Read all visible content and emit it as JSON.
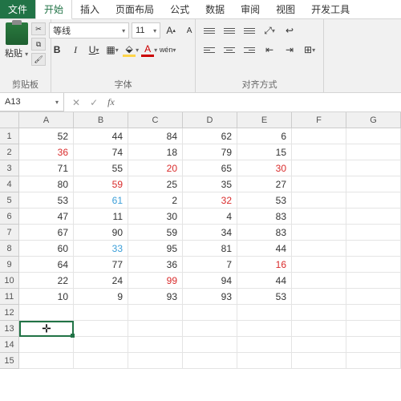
{
  "tabs": {
    "file": "文件",
    "home": "开始",
    "insert": "插入",
    "layout": "页面布局",
    "formula": "公式",
    "data": "数据",
    "review": "审阅",
    "view": "视图",
    "dev": "开发工具"
  },
  "ribbon": {
    "paste": "粘贴",
    "clipboard": "剪贴板",
    "font_name": "等线",
    "font_size": "11",
    "font_group": "字体",
    "align_group": "对齐方式",
    "wen": "wén"
  },
  "namebox": "A13",
  "columns": [
    "A",
    "B",
    "C",
    "D",
    "E",
    "F",
    "G"
  ],
  "rows": [
    "1",
    "2",
    "3",
    "4",
    "5",
    "6",
    "7",
    "8",
    "9",
    "10",
    "11",
    "12",
    "13",
    "14",
    "15"
  ],
  "selected": {
    "row": 12,
    "col": 0
  },
  "cells": [
    [
      {
        "v": "52"
      },
      {
        "v": "44"
      },
      {
        "v": "84"
      },
      {
        "v": "62"
      },
      {
        "v": "6"
      },
      {
        "v": ""
      },
      {
        "v": ""
      }
    ],
    [
      {
        "v": "36",
        "c": "red"
      },
      {
        "v": "74"
      },
      {
        "v": "18"
      },
      {
        "v": "79"
      },
      {
        "v": "15"
      },
      {
        "v": ""
      },
      {
        "v": ""
      }
    ],
    [
      {
        "v": "71"
      },
      {
        "v": "55"
      },
      {
        "v": "20",
        "c": "red"
      },
      {
        "v": "65"
      },
      {
        "v": "30",
        "c": "red"
      },
      {
        "v": ""
      },
      {
        "v": ""
      }
    ],
    [
      {
        "v": "80"
      },
      {
        "v": "59",
        "c": "red"
      },
      {
        "v": "25"
      },
      {
        "v": "35"
      },
      {
        "v": "27"
      },
      {
        "v": ""
      },
      {
        "v": ""
      }
    ],
    [
      {
        "v": "53"
      },
      {
        "v": "61",
        "c": "blue"
      },
      {
        "v": "2"
      },
      {
        "v": "32",
        "c": "red"
      },
      {
        "v": "53"
      },
      {
        "v": ""
      },
      {
        "v": ""
      }
    ],
    [
      {
        "v": "47"
      },
      {
        "v": "11"
      },
      {
        "v": "30"
      },
      {
        "v": "4"
      },
      {
        "v": "83"
      },
      {
        "v": ""
      },
      {
        "v": ""
      }
    ],
    [
      {
        "v": "67"
      },
      {
        "v": "90"
      },
      {
        "v": "59"
      },
      {
        "v": "34"
      },
      {
        "v": "83"
      },
      {
        "v": ""
      },
      {
        "v": ""
      }
    ],
    [
      {
        "v": "60"
      },
      {
        "v": "33",
        "c": "blue"
      },
      {
        "v": "95"
      },
      {
        "v": "81"
      },
      {
        "v": "44"
      },
      {
        "v": ""
      },
      {
        "v": ""
      }
    ],
    [
      {
        "v": "64"
      },
      {
        "v": "77"
      },
      {
        "v": "36"
      },
      {
        "v": "7"
      },
      {
        "v": "16",
        "c": "red"
      },
      {
        "v": ""
      },
      {
        "v": ""
      }
    ],
    [
      {
        "v": "22"
      },
      {
        "v": "24"
      },
      {
        "v": "99",
        "c": "red"
      },
      {
        "v": "94"
      },
      {
        "v": "44"
      },
      {
        "v": ""
      },
      {
        "v": ""
      }
    ],
    [
      {
        "v": "10"
      },
      {
        "v": "9"
      },
      {
        "v": "93"
      },
      {
        "v": "93"
      },
      {
        "v": "53"
      },
      {
        "v": ""
      },
      {
        "v": ""
      }
    ],
    [
      {
        "v": ""
      },
      {
        "v": ""
      },
      {
        "v": ""
      },
      {
        "v": ""
      },
      {
        "v": ""
      },
      {
        "v": ""
      },
      {
        "v": ""
      }
    ],
    [
      {
        "v": ""
      },
      {
        "v": ""
      },
      {
        "v": ""
      },
      {
        "v": ""
      },
      {
        "v": ""
      },
      {
        "v": ""
      },
      {
        "v": ""
      }
    ],
    [
      {
        "v": ""
      },
      {
        "v": ""
      },
      {
        "v": ""
      },
      {
        "v": ""
      },
      {
        "v": ""
      },
      {
        "v": ""
      },
      {
        "v": ""
      }
    ],
    [
      {
        "v": ""
      },
      {
        "v": ""
      },
      {
        "v": ""
      },
      {
        "v": ""
      },
      {
        "v": ""
      },
      {
        "v": ""
      },
      {
        "v": ""
      }
    ]
  ]
}
